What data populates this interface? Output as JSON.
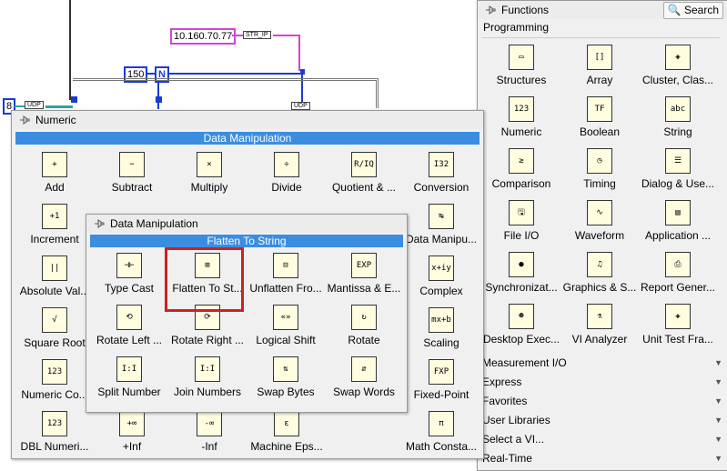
{
  "diagram": {
    "ip_constant": "10.160.70.77",
    "ip_label": "STR_IP",
    "n_constant": "150",
    "n_label": "N",
    "num_constant": "8",
    "udp_label_1": "UDP",
    "udp_label_2": "UDP"
  },
  "functions_palette": {
    "title": "Functions",
    "search_label": "Search",
    "category": "Programming",
    "items": [
      {
        "label": "Structures",
        "icon": "structures-icon",
        "glyph": "▭"
      },
      {
        "label": "Array",
        "icon": "array-icon",
        "glyph": "[]"
      },
      {
        "label": "Cluster, Clas...",
        "icon": "cluster-icon",
        "glyph": "◈"
      },
      {
        "label": "Numeric",
        "icon": "numeric-icon",
        "glyph": "123"
      },
      {
        "label": "Boolean",
        "icon": "boolean-icon",
        "glyph": "TF"
      },
      {
        "label": "String",
        "icon": "string-icon",
        "glyph": "abc"
      },
      {
        "label": "Comparison",
        "icon": "comparison-icon",
        "glyph": "≥"
      },
      {
        "label": "Timing",
        "icon": "timing-icon",
        "glyph": "◷"
      },
      {
        "label": "Dialog & Use...",
        "icon": "dialog-icon",
        "glyph": "☰"
      },
      {
        "label": "File I/O",
        "icon": "file-io-icon",
        "glyph": "🖫"
      },
      {
        "label": "Waveform",
        "icon": "waveform-icon",
        "glyph": "∿"
      },
      {
        "label": "Application ...",
        "icon": "application-icon",
        "glyph": "▤"
      },
      {
        "label": "Synchronizat...",
        "icon": "synchronization-icon",
        "glyph": "●"
      },
      {
        "label": "Graphics & S...",
        "icon": "graphics-icon",
        "glyph": "♫"
      },
      {
        "label": "Report Gener...",
        "icon": "report-icon",
        "glyph": "⎙"
      },
      {
        "label": "Desktop Exec...",
        "icon": "desktop-exec-icon",
        "glyph": "☻"
      },
      {
        "label": "VI Analyzer",
        "icon": "vi-analyzer-icon",
        "glyph": "⚗"
      },
      {
        "label": "Unit Test Fra...",
        "icon": "unit-test-icon",
        "glyph": "✚"
      }
    ],
    "subcategories": [
      "Measurement I/O",
      "Express",
      "Favorites",
      "User Libraries",
      "Select a VI...",
      "Real-Time"
    ]
  },
  "numeric_palette": {
    "title": "Numeric",
    "bar_label": "Data Manipulation",
    "items": [
      {
        "label": "Add",
        "icon": "add-icon",
        "glyph": "+"
      },
      {
        "label": "Subtract",
        "icon": "subtract-icon",
        "glyph": "−"
      },
      {
        "label": "Multiply",
        "icon": "multiply-icon",
        "glyph": "×"
      },
      {
        "label": "Divide",
        "icon": "divide-icon",
        "glyph": "÷"
      },
      {
        "label": "Quotient & ...",
        "icon": "quotient-icon",
        "glyph": "R/IQ"
      },
      {
        "label": "Conversion",
        "icon": "conversion-icon",
        "glyph": "I32"
      },
      {
        "label": "Increment",
        "icon": "increment-icon",
        "glyph": "+1"
      },
      {
        "label": "Data Manipu...",
        "icon": "data-manipulation-icon",
        "glyph": "↹"
      },
      {
        "label": "Absolute Val...",
        "icon": "absolute-value-icon",
        "glyph": "||"
      },
      {
        "label": "Complex",
        "icon": "complex-icon",
        "glyph": "x+iy"
      },
      {
        "label": "Square Root",
        "icon": "square-root-icon",
        "glyph": "√"
      },
      {
        "label": "Scaling",
        "icon": "scaling-icon",
        "glyph": "mx+b"
      },
      {
        "label": "Numeric Co...",
        "icon": "numeric-constant-icon",
        "glyph": "123"
      },
      {
        "label": "Fixed-Point",
        "icon": "fixed-point-icon",
        "glyph": "FXP"
      },
      {
        "label": "DBL Numeri...",
        "icon": "dbl-numeric-icon",
        "glyph": "123"
      },
      {
        "label": "+Inf",
        "icon": "plus-inf-icon",
        "glyph": "+∞"
      },
      {
        "label": "-Inf",
        "icon": "minus-inf-icon",
        "glyph": "-∞"
      },
      {
        "label": "Machine Eps...",
        "icon": "machine-epsilon-icon",
        "glyph": "ε"
      },
      {
        "label": "Math Consta...",
        "icon": "math-constants-icon",
        "glyph": "π"
      }
    ]
  },
  "data_manip_palette": {
    "title": "Data Manipulation",
    "bar_label": "Flatten To String",
    "items": [
      {
        "label": "Type Cast",
        "icon": "type-cast-icon",
        "glyph": "⊣⊢"
      },
      {
        "label": "Flatten To St...",
        "icon": "flatten-to-string-icon",
        "glyph": "⊞"
      },
      {
        "label": "Unflatten Fro...",
        "icon": "unflatten-from-string-icon",
        "glyph": "⊟"
      },
      {
        "label": "Mantissa & E...",
        "icon": "mantissa-exponent-icon",
        "glyph": "EXP"
      },
      {
        "label": "Rotate Left ...",
        "icon": "rotate-left-icon",
        "glyph": "⟲"
      },
      {
        "label": "Rotate Right ...",
        "icon": "rotate-right-icon",
        "glyph": "⟳"
      },
      {
        "label": "Logical Shift",
        "icon": "logical-shift-icon",
        "glyph": "«»"
      },
      {
        "label": "Rotate",
        "icon": "rotate-icon",
        "glyph": "↻"
      },
      {
        "label": "Split Number",
        "icon": "split-number-icon",
        "glyph": "I:I"
      },
      {
        "label": "Join Numbers",
        "icon": "join-numbers-icon",
        "glyph": "I:I"
      },
      {
        "label": "Swap Bytes",
        "icon": "swap-bytes-icon",
        "glyph": "⇅"
      },
      {
        "label": "Swap Words",
        "icon": "swap-words-icon",
        "glyph": "⇵"
      }
    ]
  },
  "colors": {
    "palette_bar": "#3b8de0",
    "highlight": "#d21f1f",
    "wire_blue": "#1a3cd6",
    "wire_pink": "#d246d2"
  }
}
